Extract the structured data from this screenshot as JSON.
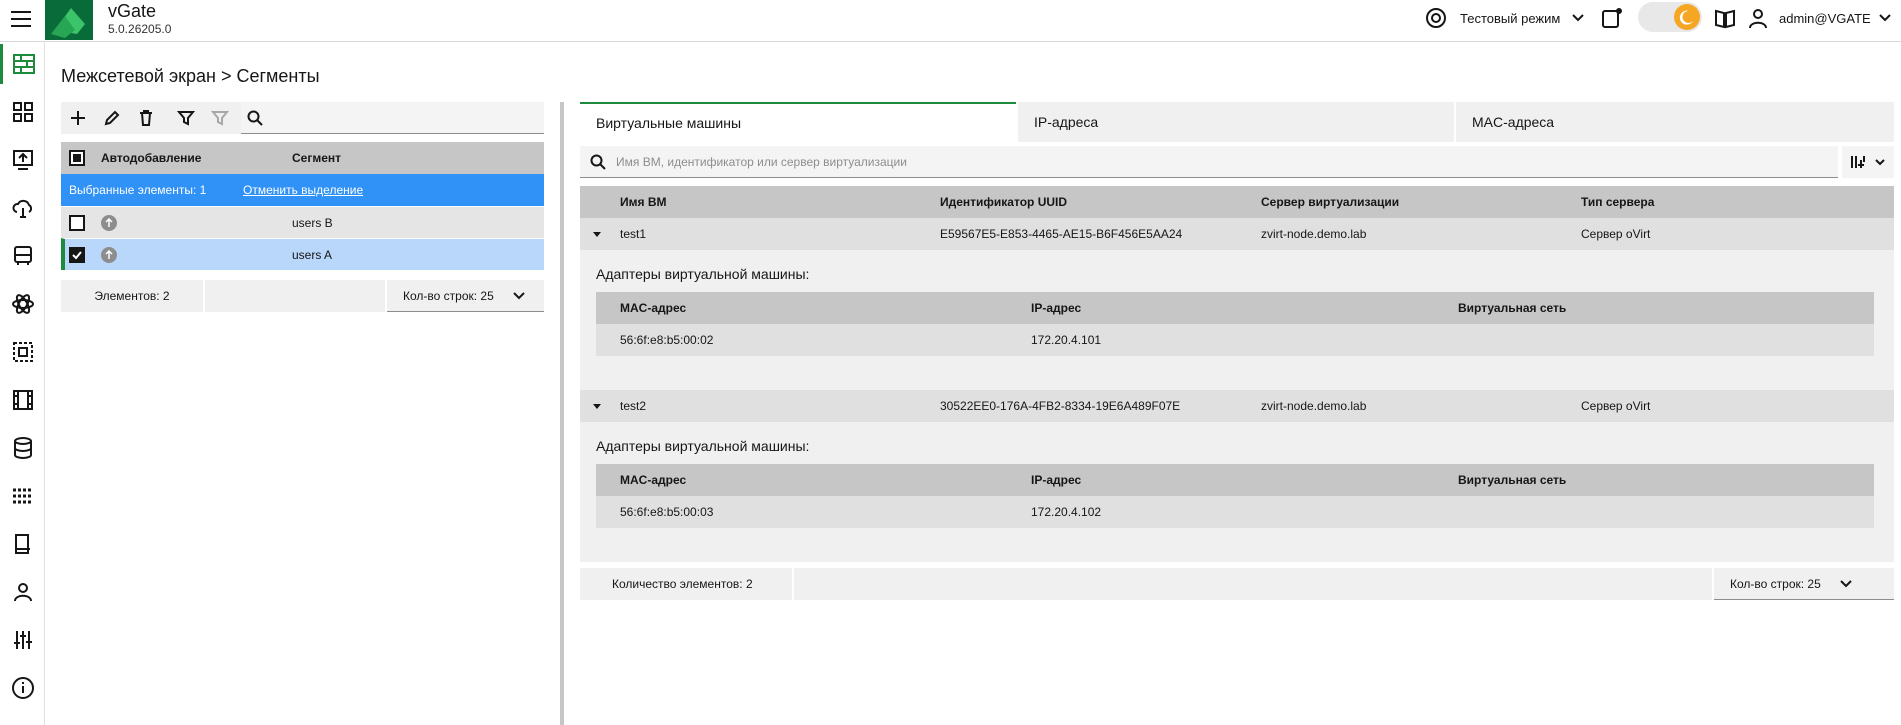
{
  "app": {
    "name": "vGate",
    "version": "5.0.26205.0"
  },
  "header": {
    "mode_label": "Тестовый режим",
    "user": "admin@VGATE"
  },
  "breadcrumb": "Межсетевой экран > Сегменты",
  "left_table": {
    "columns": [
      "Автодобавление",
      "Сегмент"
    ],
    "selection_text": "Выбранные элементы: 1",
    "clear_selection": "Отменить выделение",
    "rows": [
      {
        "segment": "users B",
        "checked": false
      },
      {
        "segment": "users A",
        "checked": true
      }
    ],
    "count_label": "Элементов: 2",
    "rows_per_page": "Кол-во строк: 25"
  },
  "tabs": [
    "Виртуальные машины",
    "IP-адреса",
    "MAC-адреса"
  ],
  "search": {
    "placeholder": "Имя ВМ, идентификатор или сервер виртуализации"
  },
  "vm_table": {
    "columns": [
      "Имя ВМ",
      "Идентификатор UUID",
      "Сервер виртуализации",
      "Тип сервера"
    ],
    "rows": [
      {
        "name": "test1",
        "uuid": "E59567E5-E853-4465-AE15-B6F456E5AA24",
        "server": "zvirt-node.demo.lab",
        "type": "Сервер oVirt",
        "adapters_title": "Адаптеры виртуальной машины:",
        "adapter_columns": [
          "MAC-адрес",
          "IP-адрес",
          "Виртуальная сеть"
        ],
        "adapters": [
          {
            "mac": "56:6f:e8:b5:00:02",
            "ip": "172.20.4.101",
            "network": ""
          }
        ]
      },
      {
        "name": "test2",
        "uuid": "30522EE0-176A-4FB2-8334-19E6A489F07E",
        "server": "zvirt-node.demo.lab",
        "type": "Сервер oVirt",
        "adapters_title": "Адаптеры виртуальной машины:",
        "adapter_columns": [
          "MAC-адрес",
          "IP-адрес",
          "Виртуальная сеть"
        ],
        "adapters": [
          {
            "mac": "56:6f:e8:b5:00:03",
            "ip": "172.20.4.102",
            "network": ""
          }
        ]
      }
    ],
    "count_label": "Количество элементов: 2",
    "rows_per_page": "Кол-во строк: 25"
  },
  "colors": {
    "accent_green": "#1d8a3e",
    "selection_blue": "#3091f6",
    "row_selected": "#b8d7fa",
    "toggle_sun": "#f5a623"
  },
  "icons": {
    "nav": [
      "firewall-icon",
      "dashboard-icon",
      "upload-icon",
      "cloud-network-icon",
      "bus-icon",
      "atom-icon",
      "network-objects-icon",
      "film-icon",
      "database-icon",
      "grid-icon",
      "document-icon",
      "user-icon",
      "sliders-icon",
      "info-icon"
    ],
    "toolbar": [
      "add-icon",
      "edit-icon",
      "delete-icon",
      "filter-icon",
      "clear-filter-icon",
      "search-icon"
    ]
  }
}
